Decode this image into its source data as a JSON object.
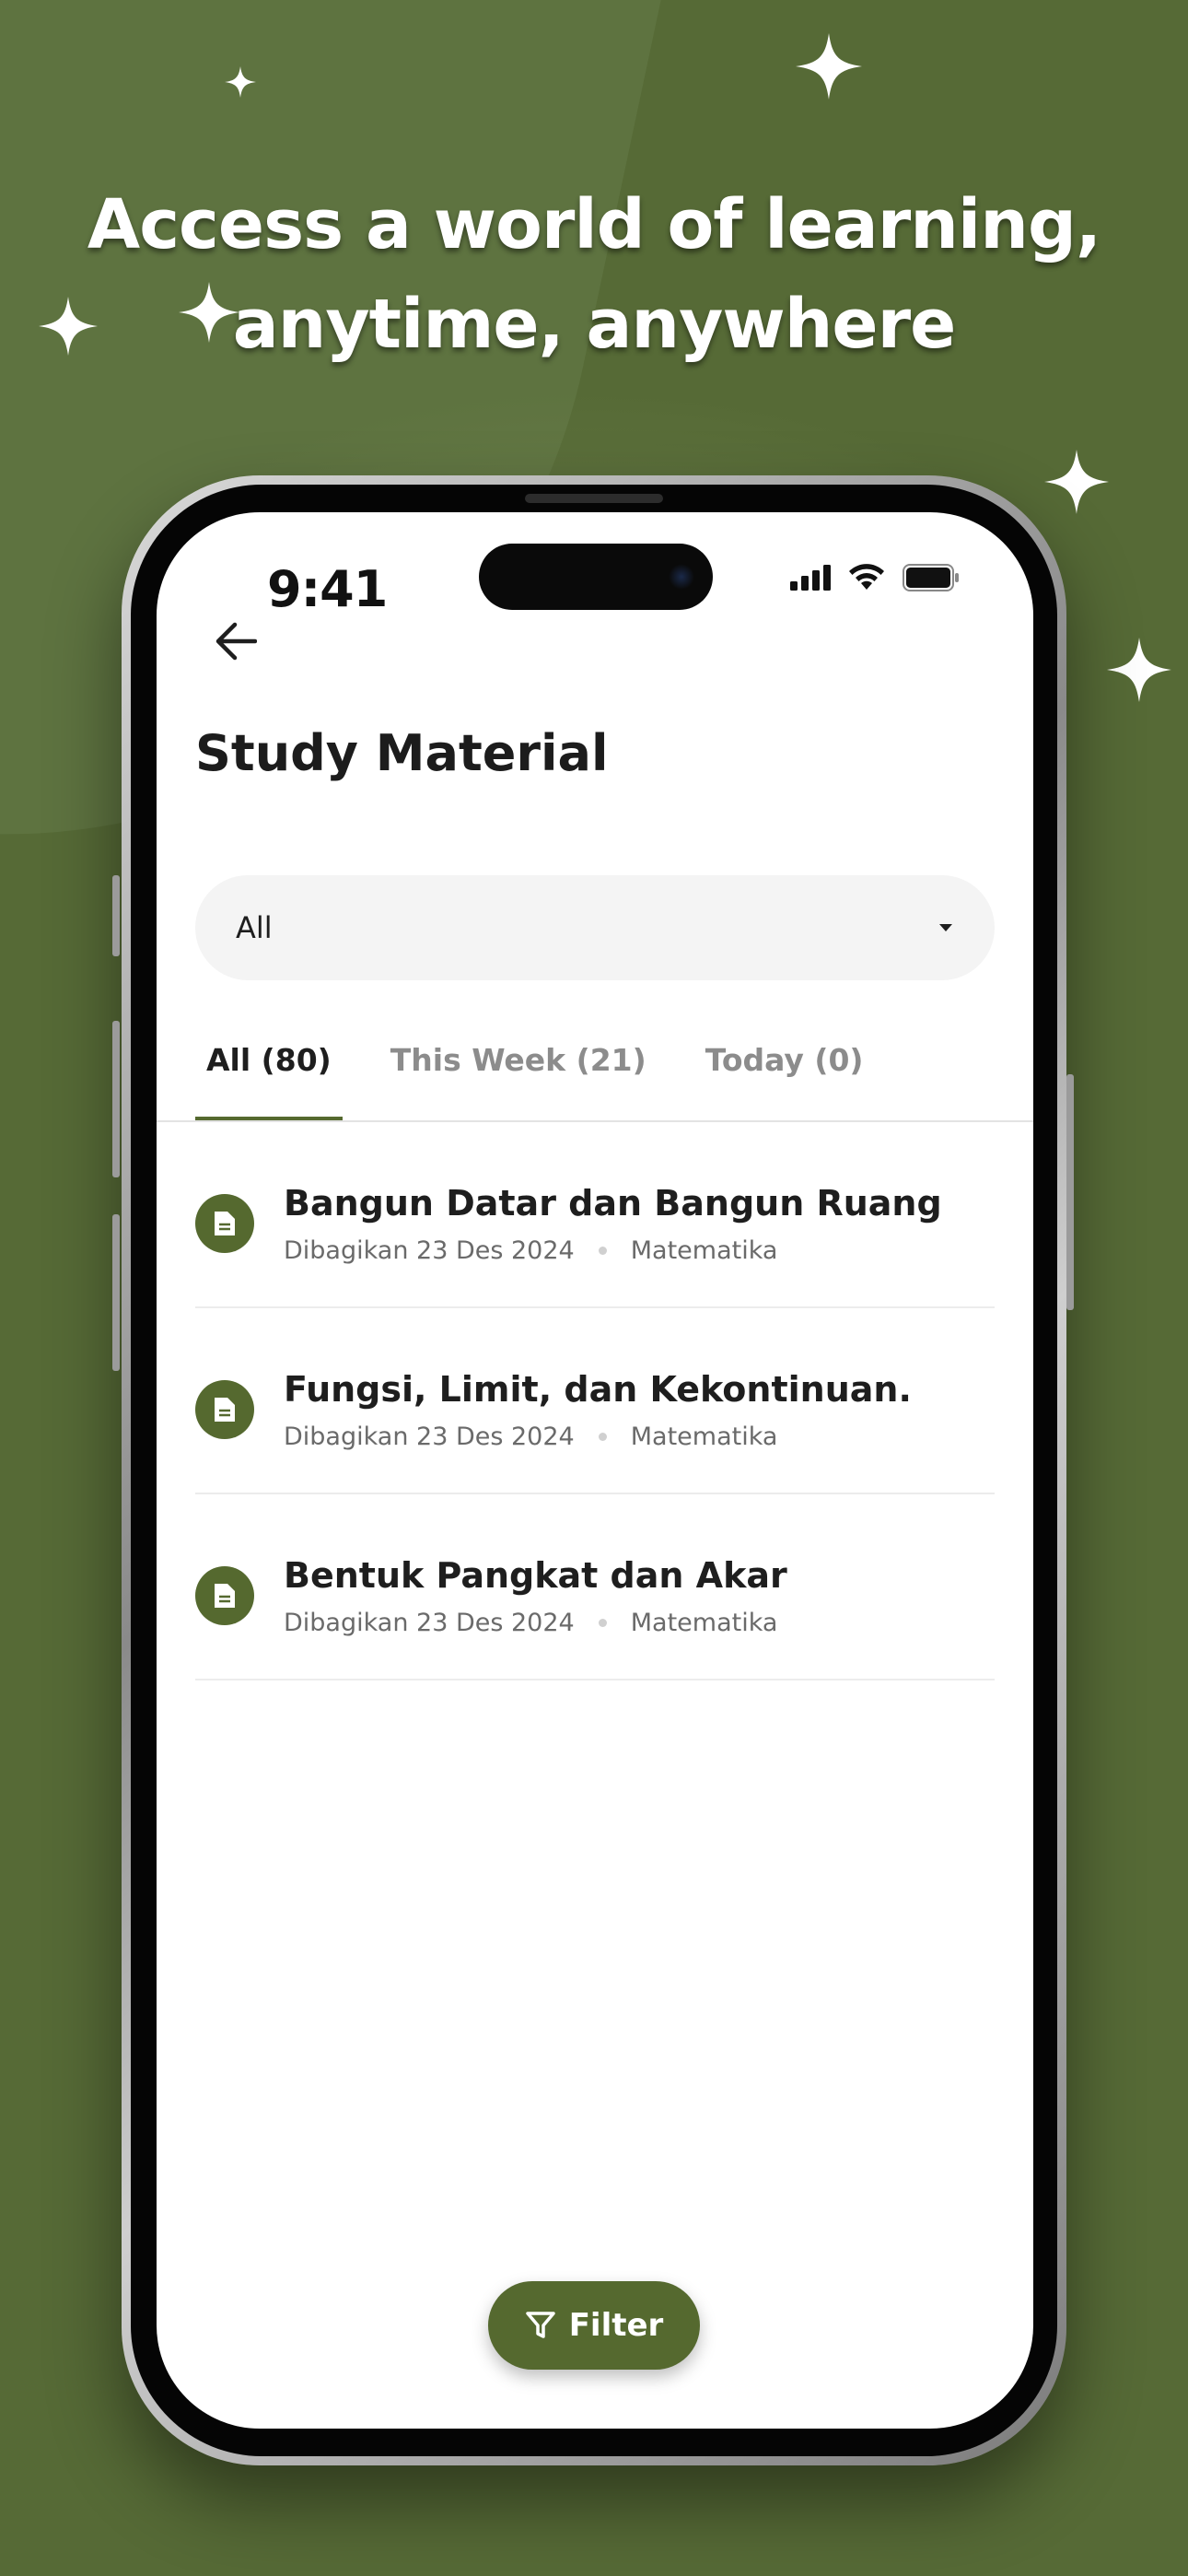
{
  "headline": {
    "line1": "Access a world of learning,",
    "line2": "anytime, anywhere"
  },
  "status_bar": {
    "time": "9:41",
    "icons": [
      "cellular-signal-icon",
      "wifi-icon",
      "battery-icon"
    ]
  },
  "header": {
    "back_icon": "arrow-left-icon",
    "title": "Study Material"
  },
  "dropdown": {
    "selected": "All",
    "icon": "caret-down-icon"
  },
  "tabs": [
    {
      "label": "All (80)",
      "active": true
    },
    {
      "label": "This Week (21)",
      "active": false
    },
    {
      "label": "Today (0)",
      "active": false
    }
  ],
  "materials": [
    {
      "title": "Bangun Datar dan Bangun Ruang",
      "shared": "Dibagikan 23 Des 2024",
      "subject": "Matematika",
      "icon": "document-icon"
    },
    {
      "title": "Fungsi, Limit, dan Kekontinuan.",
      "shared": "Dibagikan 23 Des 2024",
      "subject": "Matematika",
      "icon": "document-icon"
    },
    {
      "title": "Bentuk Pangkat dan Akar",
      "shared": "Dibagikan 23 Des 2024",
      "subject": "Matematika",
      "icon": "document-icon"
    }
  ],
  "filter_button": {
    "label": "Filter",
    "icon": "funnel-icon"
  },
  "colors": {
    "background": "#566a36",
    "accent": "#55692f",
    "text": "#1e1e1e",
    "muted": "#8c8c8c"
  }
}
